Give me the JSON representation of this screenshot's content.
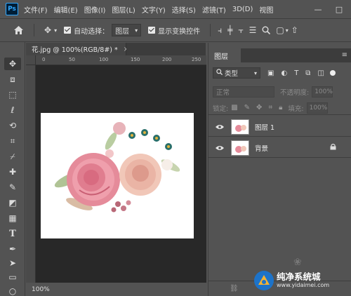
{
  "app": {
    "logo": "Ps"
  },
  "menu": [
    "文件(F)",
    "编辑(E)",
    "图像(I)",
    "图层(L)",
    "文字(Y)",
    "选择(S)",
    "滤镜(T)",
    "3D(D)",
    "视图"
  ],
  "window_controls": {
    "minimize": "—",
    "maximize": "□"
  },
  "options_bar": {
    "auto_select_label": "自动选择：",
    "auto_select_value": "图层",
    "show_transform_label": "显示变换控件"
  },
  "document": {
    "tab_title": "花.jpg @ 100%(RGB/8#) *",
    "tab_close": "×",
    "ruler_ticks": [
      "0",
      "50",
      "100",
      "150",
      "200",
      "250"
    ],
    "zoom": "100%"
  },
  "layers_panel": {
    "tab_label": "图层",
    "filter_kind": "类型",
    "blend_mode": "正常",
    "opacity_label": "不透明度:",
    "opacity_value": "100%",
    "lock_label": "锁定:",
    "fill_label": "填充:",
    "fill_value": "100%",
    "layers": [
      {
        "name": "图层 1",
        "locked": false
      },
      {
        "name": "背景",
        "locked": true
      }
    ]
  },
  "watermark": {
    "title": "纯净系统城",
    "url": "www.yidaimei.com"
  },
  "colors": {
    "app_bg": "#535353",
    "canvas_bg": "#282828",
    "accent": "#31a8ff"
  },
  "icons": [
    "home-icon",
    "move-icon",
    "eye-icon",
    "lock-icon",
    "search-icon",
    "gear-icon"
  ]
}
